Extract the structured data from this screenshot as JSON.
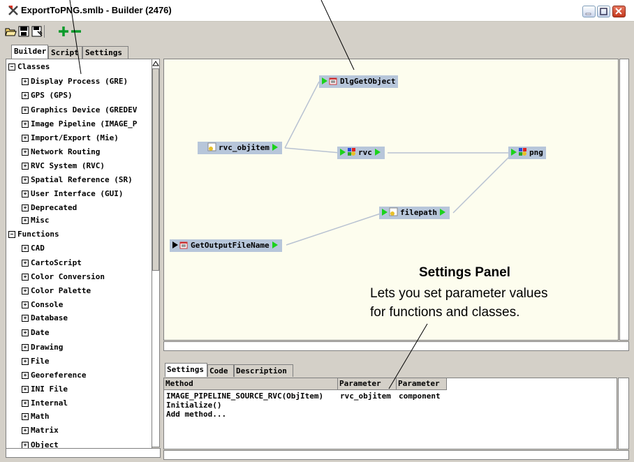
{
  "window": {
    "title": "ExportToPNG.smlb - Builder (2476)",
    "controls": [
      "minimize",
      "maximize",
      "close"
    ]
  },
  "toolbar": {
    "icons": [
      "open-icon",
      "save-icon",
      "save-as-icon",
      "add-icon",
      "remove-icon"
    ]
  },
  "left_tabs": [
    "Builder",
    "Script",
    "Settings"
  ],
  "tree": [
    {
      "label": "Classes",
      "expander": "−",
      "level": 0
    },
    {
      "label": "Display Process (GRE)",
      "expander": "+",
      "level": 1
    },
    {
      "label": "GPS (GPS)",
      "expander": "+",
      "level": 1
    },
    {
      "label": "Graphics Device (GREDEV",
      "expander": "+",
      "level": 1
    },
    {
      "label": "Image Pipeline (IMAGE_P",
      "expander": "+",
      "level": 1
    },
    {
      "label": "Import/Export (Mie)",
      "expander": "+",
      "level": 1
    },
    {
      "label": "Network Routing",
      "expander": "+",
      "level": 1
    },
    {
      "label": "RVC System (RVC)",
      "expander": "+",
      "level": 1
    },
    {
      "label": "Spatial Reference (SR)",
      "expander": "+",
      "level": 1
    },
    {
      "label": "User Interface (GUI)",
      "expander": "+",
      "level": 1
    },
    {
      "label": "Deprecated",
      "expander": "+",
      "level": 1
    },
    {
      "label": "Misc",
      "expander": "+",
      "level": 1
    },
    {
      "label": "Functions",
      "expander": "−",
      "level": 0
    },
    {
      "label": "CAD",
      "expander": "+",
      "level": 1
    },
    {
      "label": "CartoScript",
      "expander": "+",
      "level": 1
    },
    {
      "label": "Color Conversion",
      "expander": "+",
      "level": 1
    },
    {
      "label": "Color Palette",
      "expander": "+",
      "level": 1
    },
    {
      "label": "Console",
      "expander": "+",
      "level": 1
    },
    {
      "label": "Database",
      "expander": "+",
      "level": 1
    },
    {
      "label": "Date",
      "expander": "+",
      "level": 1
    },
    {
      "label": "Drawing",
      "expander": "+",
      "level": 1
    },
    {
      "label": "File",
      "expander": "+",
      "level": 1
    },
    {
      "label": "Georeference",
      "expander": "+",
      "level": 1
    },
    {
      "label": "INI File",
      "expander": "+",
      "level": 1
    },
    {
      "label": "Internal",
      "expander": "+",
      "level": 1
    },
    {
      "label": "Math",
      "expander": "+",
      "level": 1
    },
    {
      "label": "Matrix",
      "expander": "+",
      "level": 1
    },
    {
      "label": "Object",
      "expander": "+",
      "level": 1
    }
  ],
  "nodes": {
    "dlg": "DlgGetObject",
    "objitem": "rvc_objitem",
    "rvc": "rvc",
    "png": "png",
    "filepath": "filepath",
    "getout": "GetOutputFileName"
  },
  "bottom_tabs": [
    "Settings",
    "Code",
    "Description"
  ],
  "settings_table": {
    "headers": [
      "Method",
      "Parameter",
      "Parameter"
    ],
    "rows": [
      [
        "IMAGE_PIPELINE_SOURCE_RVC(ObjItem)",
        "rvc_objitem",
        "component"
      ],
      [
        "Initialize()",
        "",
        ""
      ],
      [
        "Add method...",
        "",
        ""
      ]
    ]
  },
  "callout": {
    "title": "Settings Panel",
    "line1": "Lets you set parameter values",
    "line2": "for functions and classes."
  },
  "colors": {
    "canvas_bg": "#fdfdee",
    "node_bg": "#b7c6da",
    "port_green": "#1bd21b",
    "connector": "#b8c2d2"
  }
}
